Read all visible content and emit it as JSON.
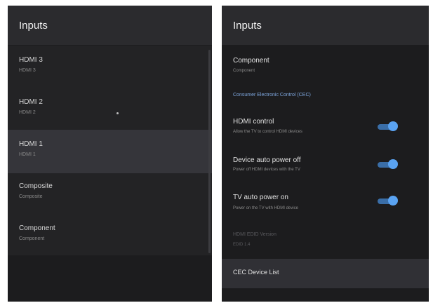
{
  "left": {
    "header": "Inputs",
    "items": [
      {
        "title": "HDMI 3",
        "subtitle": "HDMI 3"
      },
      {
        "title": "HDMI 2",
        "subtitle": "HDMI 2"
      },
      {
        "title": "HDMI 1",
        "subtitle": "HDMI 1"
      },
      {
        "title": "Composite",
        "subtitle": "Composite"
      },
      {
        "title": "Component",
        "subtitle": "Component"
      }
    ],
    "selected_index": 2
  },
  "right": {
    "header": "Inputs",
    "component": {
      "title": "Component",
      "subtitle": "Component"
    },
    "cec_link": "Consumer Electronic Control (CEC)",
    "toggles": [
      {
        "title": "HDMI control",
        "subtitle": "Allow the TV to control HDMI devices",
        "on": true
      },
      {
        "title": "Device auto power off",
        "subtitle": "Power off HDMI devices with the TV",
        "on": true
      },
      {
        "title": "TV auto power on",
        "subtitle": "Power on the TV with HDMI device",
        "on": true
      }
    ],
    "hdmi_version": {
      "title": "HDMI EDID Version",
      "value": "EDID 1.4"
    },
    "cec_device_list": "CEC Device List"
  },
  "colors": {
    "accent": "#5aa3f2",
    "panel": "#1c1c1e",
    "header": "#2b2b2e"
  }
}
